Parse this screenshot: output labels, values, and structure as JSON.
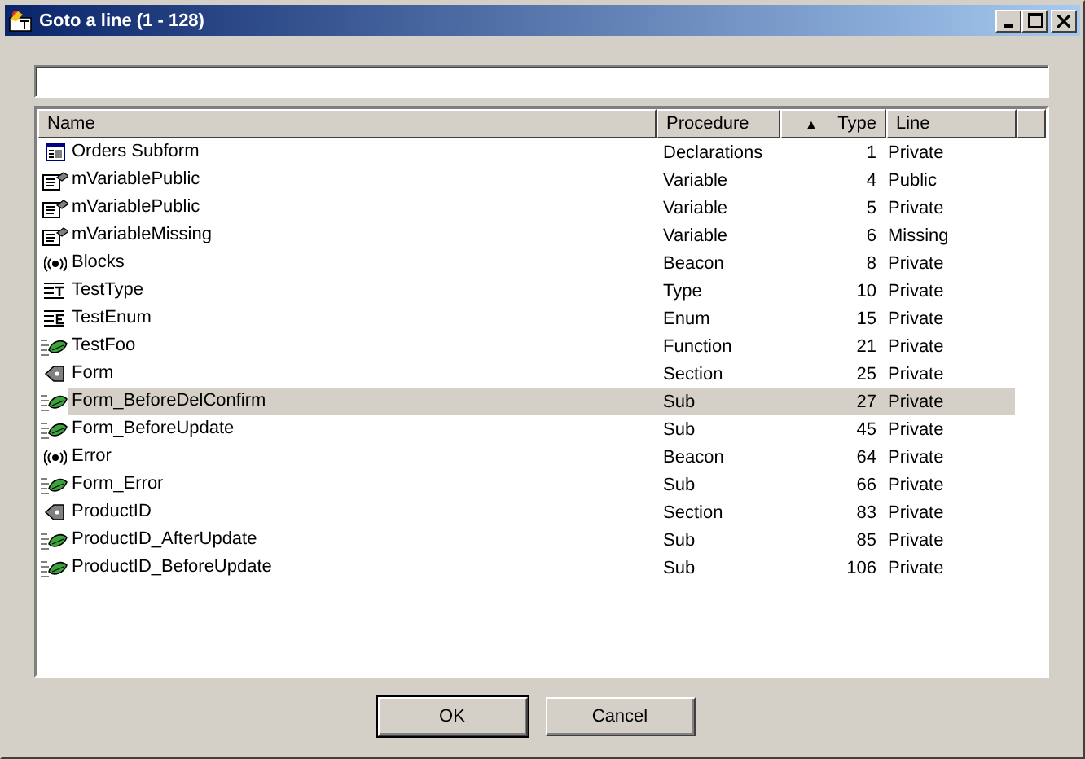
{
  "window": {
    "title": "Goto a line (1 - 128)"
  },
  "columns": [
    {
      "label": "Name"
    },
    {
      "label": "Procedure"
    },
    {
      "label": "Type",
      "sort_glyph": "▲"
    },
    {
      "label": "Line"
    }
  ],
  "rows": [
    {
      "kind": "form",
      "name": "Orders Subform",
      "procedure": "Declarations",
      "type": "1",
      "line": "Private",
      "selected": false
    },
    {
      "kind": "variable",
      "name": "mVariablePublic",
      "procedure": "Variable",
      "type": "4",
      "line": "Public",
      "selected": false
    },
    {
      "kind": "variable",
      "name": "mVariablePublic",
      "procedure": "Variable",
      "type": "5",
      "line": "Private",
      "selected": false
    },
    {
      "kind": "variable",
      "name": "mVariableMissing",
      "procedure": "Variable",
      "type": "6",
      "line": "Missing",
      "selected": false
    },
    {
      "kind": "beacon",
      "name": "Blocks",
      "procedure": "Beacon",
      "type": "8",
      "line": "Private",
      "selected": false
    },
    {
      "kind": "type",
      "name": "TestType",
      "procedure": "Type",
      "type": "10",
      "line": "Private",
      "selected": false
    },
    {
      "kind": "enum",
      "name": "TestEnum",
      "procedure": "Enum",
      "type": "15",
      "line": "Private",
      "selected": false
    },
    {
      "kind": "function",
      "name": "TestFoo",
      "procedure": "Function",
      "type": "21",
      "line": "Private",
      "selected": false
    },
    {
      "kind": "section",
      "name": "Form",
      "procedure": "Section",
      "type": "25",
      "line": "Private",
      "selected": false
    },
    {
      "kind": "sub",
      "name": "Form_BeforeDelConfirm",
      "procedure": "Sub",
      "type": "27",
      "line": "Private",
      "selected": true
    },
    {
      "kind": "sub",
      "name": "Form_BeforeUpdate",
      "procedure": "Sub",
      "type": "45",
      "line": "Private",
      "selected": false
    },
    {
      "kind": "beacon",
      "name": "Error",
      "procedure": "Beacon",
      "type": "64",
      "line": "Private",
      "selected": false
    },
    {
      "kind": "sub",
      "name": "Form_Error",
      "procedure": "Sub",
      "type": "66",
      "line": "Private",
      "selected": false
    },
    {
      "kind": "section",
      "name": "ProductID",
      "procedure": "Section",
      "type": "83",
      "line": "Private",
      "selected": false
    },
    {
      "kind": "sub",
      "name": "ProductID_AfterUpdate",
      "procedure": "Sub",
      "type": "85",
      "line": "Private",
      "selected": false
    },
    {
      "kind": "sub",
      "name": "ProductID_BeforeUpdate",
      "procedure": "Sub",
      "type": "106",
      "line": "Private",
      "selected": false
    }
  ],
  "buttons": [
    {
      "label": "OK",
      "default": true
    },
    {
      "label": "Cancel",
      "default": false
    }
  ]
}
